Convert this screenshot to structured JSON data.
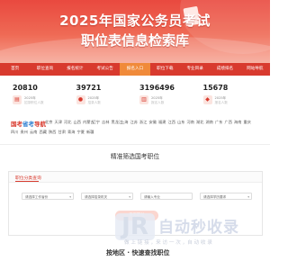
{
  "hero": {
    "line1": "2025年国家公务员考试",
    "line2": "职位表信息检索库"
  },
  "nav": {
    "items": [
      "首页",
      "职位查询",
      "报名统计",
      "考试公告",
      "报名入口",
      "职位下载",
      "专业目录",
      "成绩排名",
      "网站导航"
    ],
    "active_index": 4
  },
  "stats": [
    {
      "value": "20810",
      "line1": "2025年",
      "line2": "招录职位人数",
      "icon": "doc-icon"
    },
    {
      "value": "39721",
      "line1": "2025年",
      "line2": "招录人数",
      "icon": "user-icon"
    },
    {
      "value": "3196496",
      "line1": "2025年",
      "line2": "报名人数",
      "icon": "chart-icon"
    },
    {
      "value": "15678",
      "line1": "2025年",
      "line2": "报名人数",
      "icon": "group-icon"
    }
  ],
  "province": {
    "logo_a": "国考",
    "logo_b": "省考",
    "logo_c": "导航",
    "row1": [
      "北京",
      "天津",
      "河北",
      "山西",
      "内蒙古",
      "辽宁",
      "吉林",
      "黑龙江",
      "上海",
      "江苏",
      "浙江",
      "安徽",
      "福建",
      "江西",
      "山东",
      "河南",
      "湖北",
      "湖南",
      "广东",
      "广西",
      "海南",
      "重庆"
    ],
    "row2": [
      "四川",
      "贵州",
      "云南",
      "西藏",
      "陕西",
      "甘肃",
      "青海",
      "宁夏",
      "新疆"
    ]
  },
  "section": {
    "title": "精准筛选国考职位"
  },
  "panel": {
    "title": "职位分类查询",
    "selects": [
      "请选择工作省份",
      "请选择招录机关",
      "请输入专业",
      "请选择学历要求"
    ],
    "search_label": "查询职位"
  },
  "watermark": {
    "badge": "JR",
    "title": "自动秒收录",
    "sub": "做 上 链 接 ，来 访 一 次 ，自 动 收 录"
  },
  "bottom": {
    "text": "按地区 · 快速查找职位"
  },
  "colors": {
    "brand_red": "#d83a2e",
    "active_orange": "#f08a3a"
  }
}
